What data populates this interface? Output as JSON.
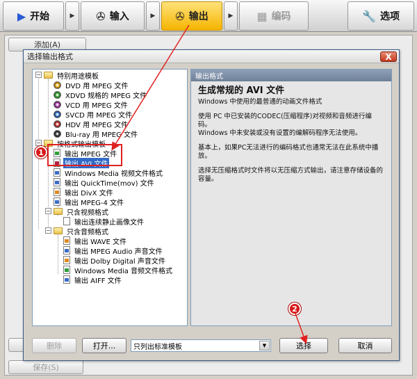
{
  "toolbar": {
    "start": "开始",
    "input": "输入",
    "output": "输出",
    "encode": "编码",
    "options": "选项"
  },
  "background": {
    "add": "添加(A)",
    "delete": "删除",
    "save": "保存(S)"
  },
  "dialog": {
    "title": "选择输出格式",
    "close": "X",
    "tree": {
      "special": "特别用途模板",
      "dvd": "DVD 用 MPEG 文件",
      "xdvd": "XDVD 规格的 MPEG 文件",
      "vcd": "VCD 用 MPEG 文件",
      "svcd": "SVCD 用 MPEG 文件",
      "hdv": "HDV 用 MPEG 文件",
      "bluray": "Blu-ray 用 MPEG 文件",
      "byformat": "按格式输出模板",
      "mpeg": "输出 MPEG 文件",
      "avi": "输出 AVI 文件",
      "wmv": "Windows Media 视频文件格式",
      "mov": "输出 QuickTime(mov) 文件",
      "divx": "输出 DivX 文件",
      "mpeg4": "输出 MPEG-4 文件",
      "videoonly": "只含视频格式",
      "stills": "输出连续静止画像文件",
      "audioonly": "只含音频格式",
      "wave": "输出 WAVE 文件",
      "mpegaudio": "输出 MPEG Audio 声音文件",
      "dolby": "输出 Dolby Digital 声音文件",
      "wma": "Windows Media 音频文件格式",
      "aiff": "输出 AIFF 文件"
    },
    "info": {
      "header": "输出格式",
      "title": "生成常规的 AVI 文件",
      "p1": "Windows 中使用的最普通的动画文件格式",
      "p2a": "使用 PC 中已安装的CODEC(压缩程序)对视频和音频进行编码。",
      "p2b": "Windows 中未安装或没有设置的编解码程序无法使用。",
      "p3": "基本上，如果PC无法进行的编码格式也通常无法在此系统中播放。",
      "p4": "选择无压缩格式时文件将以无压缩方式输出，请注意存储设备的容量。"
    },
    "delete": "删除",
    "open": "打开...",
    "combo": "只列出标准模板",
    "select": "选择",
    "cancel": "取消"
  },
  "annotations": {
    "badge1": "1",
    "badge2": "2",
    "color": "#e02020"
  }
}
